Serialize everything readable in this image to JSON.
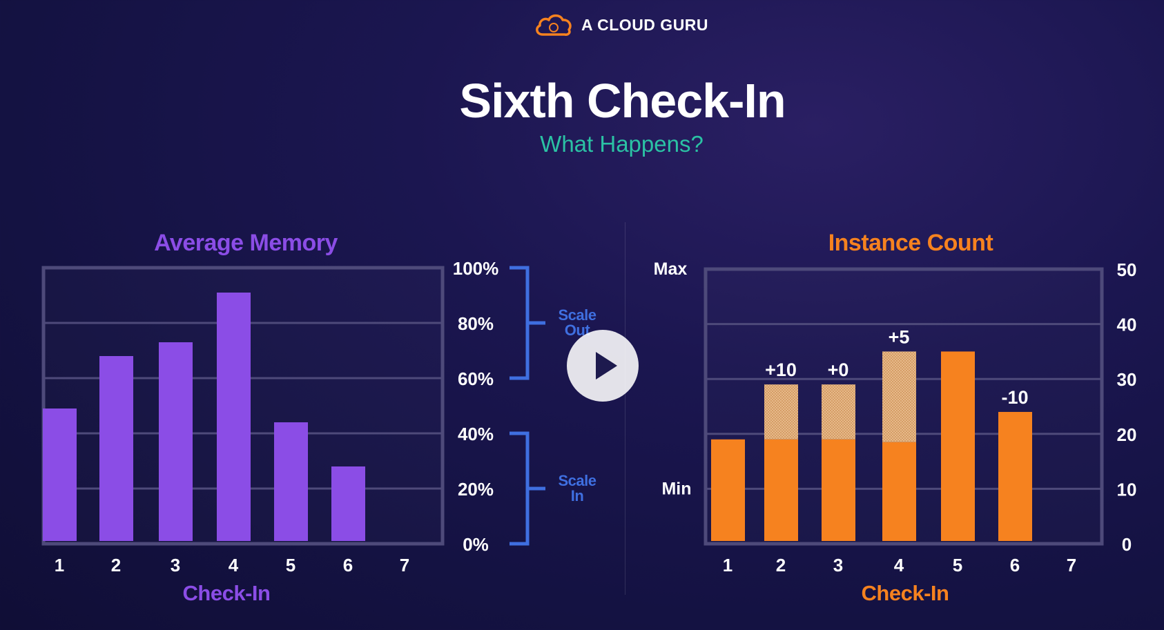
{
  "brand": {
    "name": "A CLOUD GURU"
  },
  "slide": {
    "title": "Sixth Check-In",
    "subtitle": "What Happens?"
  },
  "colors": {
    "memory": "#8b4de6",
    "instances": "#f6821f",
    "bracket": "#3f6fe0",
    "subtitle": "#2bc2a4"
  },
  "chart_data": [
    {
      "type": "bar",
      "title": "Average Memory",
      "xlabel": "Check-In",
      "categories": [
        "1",
        "2",
        "3",
        "4",
        "5",
        "6",
        "7"
      ],
      "values": [
        49,
        68,
        73,
        91,
        44,
        28,
        null
      ],
      "ylim": [
        0,
        100
      ],
      "y_ticks": [
        "0%",
        "20%",
        "40%",
        "60%",
        "80%",
        "100%"
      ],
      "grid": true,
      "annotations": {
        "scale_out": {
          "label": "Scale Out",
          "range": [
            60,
            100
          ]
        },
        "scale_in": {
          "label": "Scale In",
          "range": [
            0,
            40
          ]
        }
      }
    },
    {
      "type": "bar",
      "title": "Instance Count",
      "xlabel": "Check-In",
      "categories": [
        "1",
        "2",
        "3",
        "4",
        "5",
        "6",
        "7"
      ],
      "values": [
        19,
        29,
        29,
        35,
        35,
        24,
        null
      ],
      "base_values": [
        19,
        19,
        19,
        18.5,
        35,
        24,
        null
      ],
      "change_labels": [
        "",
        "+10",
        "+0",
        "+5",
        "",
        "-10",
        ""
      ],
      "ylim": [
        0,
        50
      ],
      "y_ticks": [
        "0",
        "10",
        "20",
        "30",
        "40",
        "50"
      ],
      "grid": true,
      "limits": {
        "max": {
          "label": "Max",
          "value": 50
        },
        "min": {
          "label": "Min",
          "value": 10
        }
      }
    }
  ]
}
